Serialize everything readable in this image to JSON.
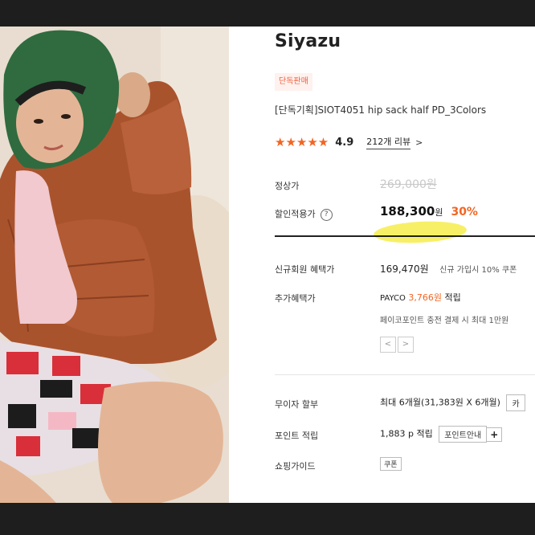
{
  "brand": "Siyazu",
  "badge": "단독판매",
  "product_name": "[단독기획]SIOT4051 hip sack half PD_3Colors",
  "rating": {
    "stars": "★★★★★",
    "score": "4.9",
    "reviews": "212개 리뷰",
    "chevron": ">"
  },
  "prices": {
    "regular_label": "정상가",
    "regular_value": "269,000원",
    "sale_label": "할인적용가",
    "info_icon": "?",
    "sale_value": "188,300",
    "sale_unit": "원",
    "discount": "30%"
  },
  "benefits": {
    "member_label": "신규회원 혜택가",
    "member_value": "169,470원",
    "member_note": "신규 가입시 10% 쿠폰",
    "extra_label": "추가혜택가",
    "payco_prefix": "PAYCO",
    "payco_amount": "3,766원",
    "payco_suffix": "적립",
    "payco_note": "페이코포인트 충전 결제 시 최대 1만원",
    "prev": "<",
    "next": ">"
  },
  "payment": {
    "installment_label": "무이자 할부",
    "installment_value": "최대 6개월(31,383원 X 6개월)",
    "installment_button": "카",
    "points_label": "포인트 적립",
    "points_value": "1,883 p 적립",
    "points_button": "포인트안내",
    "points_plus": "+",
    "guide_label": "쇼핑가이드",
    "guide_tag": "쿠폰"
  },
  "colors": {
    "accent": "#f26522",
    "highlight": "#f6ee55"
  }
}
